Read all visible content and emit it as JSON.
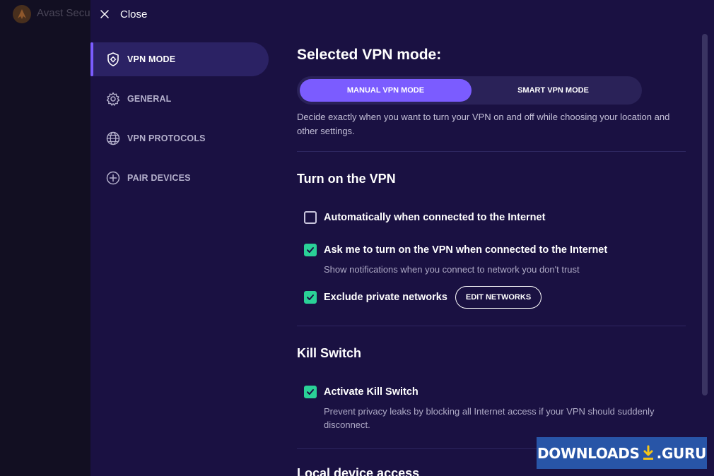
{
  "background_app": {
    "title": "Avast Secu"
  },
  "panel": {
    "close_label": "Close"
  },
  "nav": {
    "items": [
      {
        "label": "VPN MODE",
        "icon": "shield-gear-icon",
        "active": true
      },
      {
        "label": "GENERAL",
        "icon": "gear-icon",
        "active": false
      },
      {
        "label": "VPN PROTOCOLS",
        "icon": "globe-icon",
        "active": false
      },
      {
        "label": "PAIR DEVICES",
        "icon": "plus-circle-icon",
        "active": false
      }
    ]
  },
  "main": {
    "title": "Selected VPN mode:",
    "modes": {
      "manual": "MANUAL VPN MODE",
      "smart": "SMART VPN MODE",
      "selected": "manual"
    },
    "mode_description": "Decide exactly when you want to turn your VPN on and off while choosing your location and other settings.",
    "turn_on": {
      "heading": "Turn on the VPN",
      "auto_connect": {
        "label": "Automatically when connected to the Internet",
        "checked": false
      },
      "ask_me": {
        "label": "Ask me to turn on the VPN when connected to the Internet",
        "checked": true,
        "description": "Show notifications when you connect to network you don't trust"
      },
      "exclude_private": {
        "label": "Exclude private networks",
        "checked": true,
        "button": "EDIT NETWORKS"
      }
    },
    "kill_switch": {
      "heading": "Kill Switch",
      "activate": {
        "label": "Activate Kill Switch",
        "checked": true,
        "description": "Prevent privacy leaks by blocking all Internet access if your VPN should suddenly disconnect."
      }
    },
    "next_heading": "Local device access"
  },
  "watermark": {
    "part1": "DOWNLOADS",
    "part2": ".GURU"
  },
  "colors": {
    "panel_bg": "#1a1142",
    "accent": "#7b5cff",
    "checkbox": "#2ad197",
    "watermark_bg": "#2855a7"
  }
}
